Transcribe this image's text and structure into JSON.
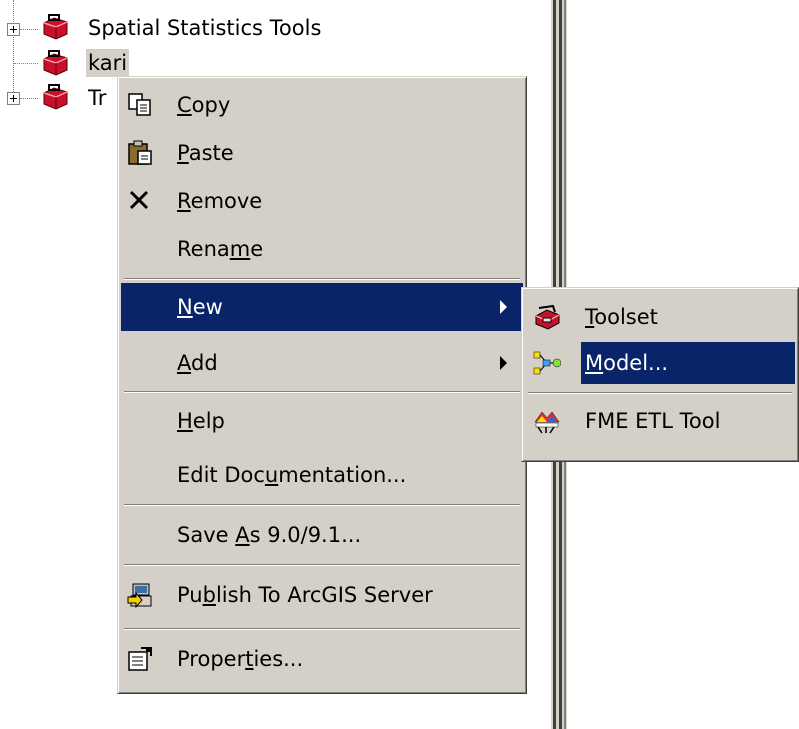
{
  "tree": {
    "items": [
      {
        "label": "Spatial Statistics Tools",
        "expandable": true
      },
      {
        "label": "kari",
        "expandable": false,
        "selected": true
      },
      {
        "label": "Tr",
        "expandable": true
      }
    ]
  },
  "context_menu": {
    "items": [
      {
        "pre": "",
        "u": "C",
        "post": "opy",
        "icon": "copy-icon"
      },
      {
        "pre": "",
        "u": "P",
        "post": "aste",
        "icon": "paste-icon"
      },
      {
        "pre": "",
        "u": "R",
        "post": "emove",
        "icon": "remove-icon"
      },
      {
        "pre": "Rena",
        "u": "m",
        "post": "e",
        "icon": ""
      },
      {
        "pre": "",
        "u": "N",
        "post": "ew",
        "icon": "",
        "submenu": true,
        "highlight": true
      },
      {
        "pre": "",
        "u": "A",
        "post": "dd",
        "icon": "",
        "submenu": true
      },
      {
        "pre": "",
        "u": "H",
        "post": "elp",
        "icon": ""
      },
      {
        "pre": "Edit Doc",
        "u": "u",
        "post": "mentation...",
        "icon": ""
      },
      {
        "pre": "Save ",
        "u": "A",
        "post": "s 9.0/9.1...",
        "icon": ""
      },
      {
        "pre": "Pu",
        "u": "b",
        "post": "lish To ArcGIS Server",
        "icon": "publish-icon"
      },
      {
        "pre": "Proper",
        "u": "t",
        "post": "ies...",
        "icon": "properties-icon"
      }
    ]
  },
  "submenu": {
    "items": [
      {
        "pre": "",
        "u": "T",
        "post": "oolset",
        "icon": "toolset-icon"
      },
      {
        "pre": "",
        "u": "M",
        "post": "odel...",
        "icon": "model-icon",
        "highlight": true
      },
      {
        "pre": "FME ETL Tool",
        "u": "",
        "post": "",
        "icon": "fme-icon"
      }
    ]
  },
  "colors": {
    "menu_bg": "#d4d0c8",
    "highlight": "#0a246a",
    "toolbox_red": "#c8102e"
  }
}
